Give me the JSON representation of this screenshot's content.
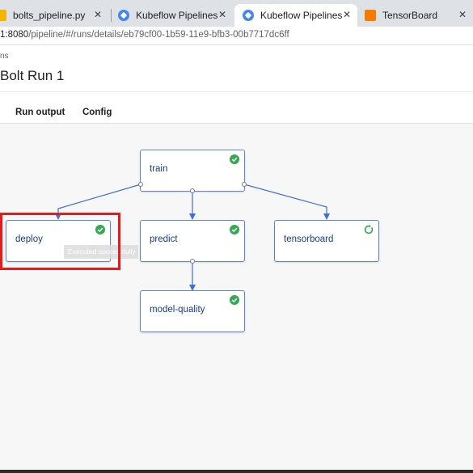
{
  "browser": {
    "tabs": [
      {
        "label": "bolts_pipeline.py",
        "icon": "python-file-icon"
      },
      {
        "label": "Kubeflow Pipelines",
        "icon": "kubeflow-icon"
      },
      {
        "label": "Kubeflow Pipelines",
        "icon": "kubeflow-icon",
        "active": true
      },
      {
        "label": "TensorBoard",
        "icon": "tensorboard-icon"
      }
    ],
    "close_glyph": "✕",
    "url_host": "1:8080",
    "url_path": "/pipeline/#/runs/details/eb79cf00-1b59-11e9-bfb3-00b7717dc6ff"
  },
  "page": {
    "breadcrumb": "ns",
    "title": "Bolt Run 1",
    "tabs": [
      "Run output",
      "Config"
    ]
  },
  "graph": {
    "nodes": [
      {
        "id": "train",
        "label": "train",
        "status": "succeeded"
      },
      {
        "id": "deploy",
        "label": "deploy",
        "status": "succeeded"
      },
      {
        "id": "predict",
        "label": "predict",
        "status": "succeeded"
      },
      {
        "id": "tensorboard",
        "label": "tensorboard",
        "status": "running"
      },
      {
        "id": "model-quality",
        "label": "model-quality",
        "status": "succeeded"
      }
    ],
    "edges": [
      {
        "from": "train",
        "to": "deploy"
      },
      {
        "from": "train",
        "to": "predict"
      },
      {
        "from": "train",
        "to": "tensorboard"
      },
      {
        "from": "predict",
        "to": "model-quality"
      }
    ],
    "tooltip": "Executed successfully"
  },
  "colors": {
    "node_border": "#5b84d9",
    "node_label": "#1a3a8a",
    "edge": "#3f6fd8",
    "success": "#34a853",
    "highlight": "#e21b1b",
    "canvas": "#f7f7f7"
  }
}
